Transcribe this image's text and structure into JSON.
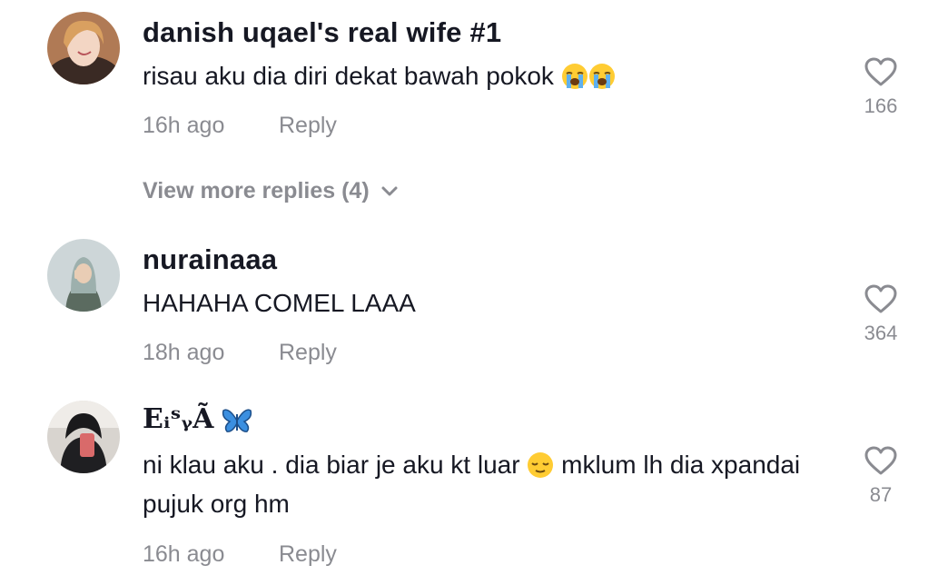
{
  "comments": [
    {
      "username": "danish uqael's real wife #1",
      "text": "risau aku dia diri dekat bawah pokok ",
      "emoji_suffix": [
        "loudly-crying-face-emoji",
        "loudly-crying-face-emoji"
      ],
      "time": "16h ago",
      "reply_label": "Reply",
      "likes": "166"
    },
    {
      "username": "nurainaaa",
      "text": "HAHAHA COMEL LAAA",
      "time": "18h ago",
      "reply_label": "Reply",
      "likes": "364"
    },
    {
      "username": "EᵢˢᵧÃ",
      "username_emoji": "butterfly-emoji",
      "text_part1": "ni klau aku . dia biar je aku kt luar ",
      "text_emoji": "relieved-face-emoji",
      "text_part2": " mklum lh dia xpandai pujuk org hm",
      "time": "16h ago",
      "reply_label": "Reply",
      "likes": "87"
    }
  ],
  "view_more_replies": "View more replies (4)",
  "colors": {
    "primary_text": "#161823",
    "secondary_text": "#8a8b91"
  }
}
